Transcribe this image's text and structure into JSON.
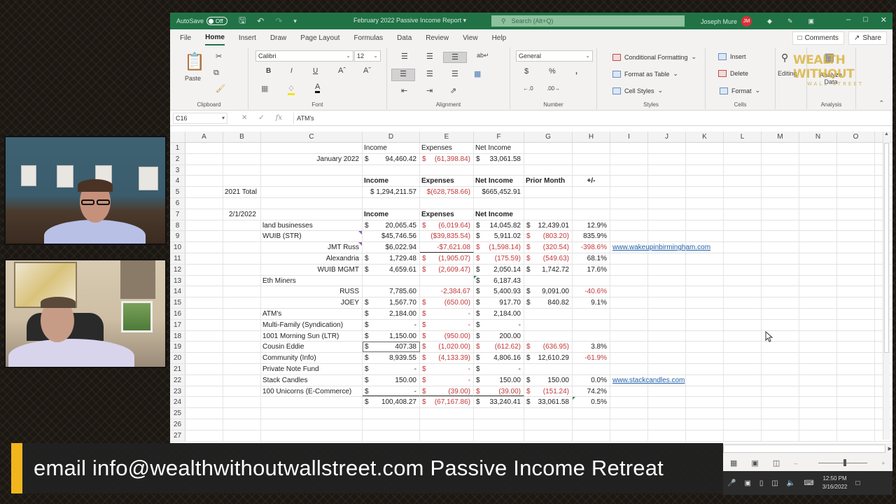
{
  "window": {
    "autosave_label": "AutoSave",
    "autosave_state": "Off",
    "doc_title": "February 2022 Passive Income Report",
    "search_placeholder": "Search (Alt+Q)",
    "user_name": "Joseph Mure",
    "user_initials": "JM"
  },
  "menu": {
    "tabs": [
      "File",
      "Home",
      "Insert",
      "Draw",
      "Page Layout",
      "Formulas",
      "Data",
      "Review",
      "View",
      "Help"
    ],
    "active": "Home",
    "comments_label": "Comments",
    "share_label": "Share"
  },
  "ribbon": {
    "clipboard": {
      "label": "Clipboard",
      "paste": "Paste"
    },
    "font": {
      "label": "Font",
      "family": "Calibri",
      "size": "12"
    },
    "alignment": {
      "label": "Alignment"
    },
    "number": {
      "label": "Number",
      "format": "General"
    },
    "styles": {
      "label": "Styles",
      "conditional": "Conditional Formatting",
      "format_table": "Format as Table",
      "cell_styles": "Cell Styles"
    },
    "cells": {
      "label": "Cells",
      "insert": "Insert",
      "delete": "Delete",
      "format": "Format"
    },
    "editing": {
      "label": "Editing"
    },
    "analysis": {
      "label": "Analysis",
      "analyze": "Analyze Data"
    }
  },
  "watermark": {
    "line1": "WEALTH WITHOUT",
    "line2": "WALL STREET"
  },
  "formula_bar": {
    "cell_ref": "C16",
    "content": "ATM's"
  },
  "columns": [
    "A",
    "B",
    "C",
    "D",
    "E",
    "F",
    "G",
    "H",
    "I",
    "J",
    "K",
    "L",
    "M",
    "N",
    "O"
  ],
  "sheet": {
    "rows": [
      {
        "n": "1",
        "D": "Income",
        "E": "Expenses",
        "F": "Net Income"
      },
      {
        "n": "2",
        "C": "January 2022",
        "D": "94,460.42",
        "E": "(61,398.84)",
        "F": "33,061.58"
      },
      {
        "n": "3"
      },
      {
        "n": "4",
        "D": "Income",
        "E": "Expenses",
        "F": "Net Income",
        "G": "Prior Month",
        "H": "+/-"
      },
      {
        "n": "5",
        "B": "2021 Total",
        "D": "$ 1,294,211.57",
        "E": "$(628,758.66)",
        "F": "$665,452.91"
      },
      {
        "n": "6"
      },
      {
        "n": "7",
        "B": "2/1/2022",
        "D": "Income",
        "E": "Expenses",
        "F": "Net Income"
      },
      {
        "n": "8",
        "C": "land businesses",
        "D": "20,065.45",
        "E": "(6,019.64)",
        "F": "14,045.82",
        "G": "12,439.01",
        "H": "12.9%"
      },
      {
        "n": "9",
        "C": "WUIB (STR)",
        "D": "$45,746.56",
        "E": "($39,835.54)",
        "F": "5,911.02",
        "G": "(803.20)",
        "H": "835.9%"
      },
      {
        "n": "10",
        "C": "JMT Russ",
        "D": "$6,022.94",
        "E": "-$7,621.08",
        "F": "(1,598.14)",
        "G": "(320.54)",
        "H": "-398.6%",
        "I": "www.wakeupinbirmingham.com"
      },
      {
        "n": "11",
        "C": "Alexandria",
        "D": "1,729.48",
        "E": "(1,905.07)",
        "F": "(175.59)",
        "G": "(549.63)",
        "H": "68.1%"
      },
      {
        "n": "12",
        "C": "WUIB MGMT",
        "D": "4,659.61",
        "E": "(2,609.47)",
        "F": "2,050.14",
        "G": "1,742.72",
        "H": "17.6%"
      },
      {
        "n": "13",
        "C": "Eth Miners",
        "F": "6,187.43"
      },
      {
        "n": "14",
        "C": "RUSS",
        "D": "7,785.60",
        "E": "-2,384.67",
        "F": "5,400.93",
        "G": "9,091.00",
        "H": "-40.6%"
      },
      {
        "n": "15",
        "C": "JOEY",
        "D": "1,567.70",
        "E": "(650.00)",
        "F": "917.70",
        "G": "840.82",
        "H": "9.1%"
      },
      {
        "n": "16",
        "C": "ATM's",
        "D": "2,184.00",
        "E": "-",
        "F": "2,184.00"
      },
      {
        "n": "17",
        "C": "Multi-Family (Syndication)",
        "D": "-",
        "E": "-",
        "F": "-"
      },
      {
        "n": "18",
        "C": "1001 Morning Sun (LTR)",
        "D": "1,150.00",
        "E": "(950.00)",
        "F": "200.00"
      },
      {
        "n": "19",
        "C": "Cousin Eddie",
        "D": "407.38",
        "E": "(1,020.00)",
        "F": "(612.62)",
        "G": "(636.95)",
        "H": "3.8%"
      },
      {
        "n": "20",
        "C": "Community  (Info)",
        "D": "8,939.55",
        "E": "(4,133.39)",
        "F": "4,806.16",
        "G": "12,610.29",
        "H": "-61.9%"
      },
      {
        "n": "21",
        "C": "Private Note Fund",
        "D": "-",
        "E": "-",
        "F": "-"
      },
      {
        "n": "22",
        "C": "Stack Candles",
        "D": "150.00",
        "E": "-",
        "F": "150.00",
        "G": "150.00",
        "H": "0.0%",
        "I": "www.stackcandles.com"
      },
      {
        "n": "23",
        "C": "100 Unicorns (E-Commerce)",
        "D": "-",
        "E": "(39.00)",
        "F": "(39.00)",
        "G": "(151.24)",
        "H": "74.2%"
      },
      {
        "n": "24",
        "D": "100,408.27",
        "E": "(67,167.86)",
        "F": "33,240.41",
        "G": "33,061.58",
        "H": "0.5%"
      },
      {
        "n": "25"
      },
      {
        "n": "26"
      },
      {
        "n": "27"
      }
    ]
  },
  "status": {
    "zoom": "100%"
  },
  "taskbar": {
    "time": "12:50 PM",
    "date": "3/16/2022"
  },
  "banner": {
    "text": "email info@wealthwithoutwallstreet.com Passive Income Retreat",
    "accent_color": "#f2b51d"
  },
  "colors": {
    "excel_green": "#217346",
    "negative": "#c0393b",
    "link": "#1f5fa8"
  }
}
